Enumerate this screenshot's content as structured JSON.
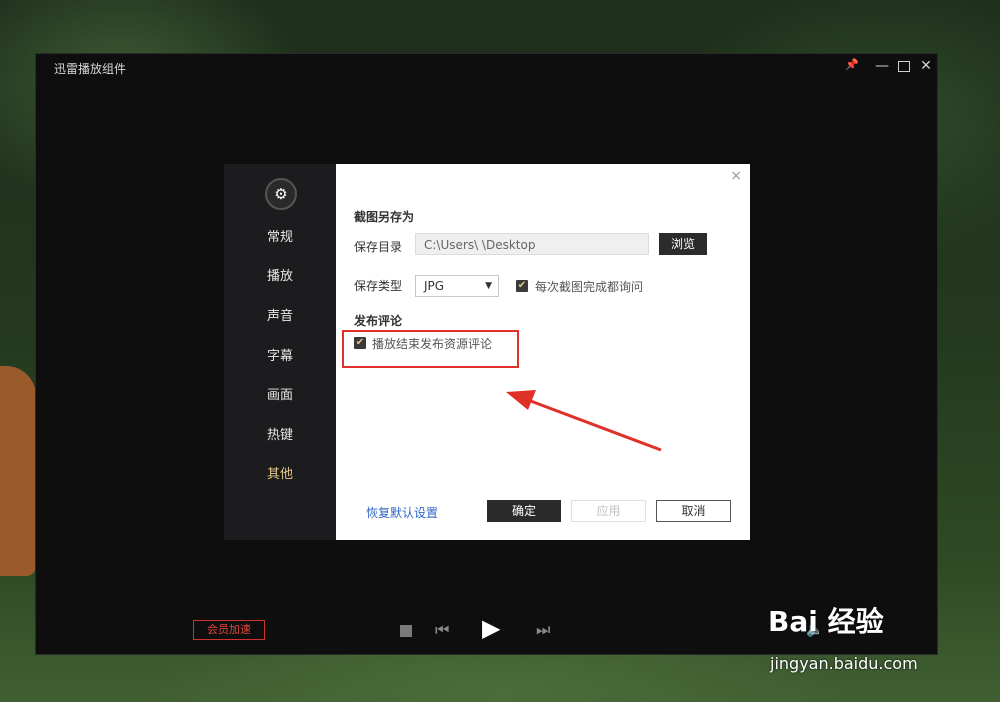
{
  "window": {
    "title": "迅雷播放组件"
  },
  "window_controls": {
    "pin": "📌",
    "minimize": "—",
    "close": "✕"
  },
  "bottom": {
    "vip_label": "会员加速"
  },
  "settings_dialog": {
    "nav": [
      {
        "label": "常规"
      },
      {
        "label": "播放"
      },
      {
        "label": "声音"
      },
      {
        "label": "字幕"
      },
      {
        "label": "画面"
      },
      {
        "label": "热键"
      },
      {
        "label": "其他",
        "active": true
      }
    ],
    "close_glyph": "×",
    "screenshot_section": {
      "title": "截图另存为",
      "dir_label": "保存目录",
      "dir_value": "C:\\Users\\  \\Desktop",
      "browse_label": "浏览",
      "type_label": "保存类型",
      "type_value": "JPG",
      "ask_checkbox_label": "每次截图完成都询问",
      "ask_checked": true
    },
    "comment_section": {
      "title": "发布评论",
      "checkbox_label": "播放结束发布资源评论",
      "checked": true
    },
    "restore_link": "恢复默认设置",
    "ok_label": "确定",
    "apply_label": "应用",
    "cancel_label": "取消"
  },
  "watermark": {
    "logo": "Bai 经验",
    "url": "jingyan.baidu.com"
  },
  "colors": {
    "accent_gold": "#e6c78e",
    "highlight_red": "#e0302a",
    "link_blue": "#2e66c8"
  }
}
